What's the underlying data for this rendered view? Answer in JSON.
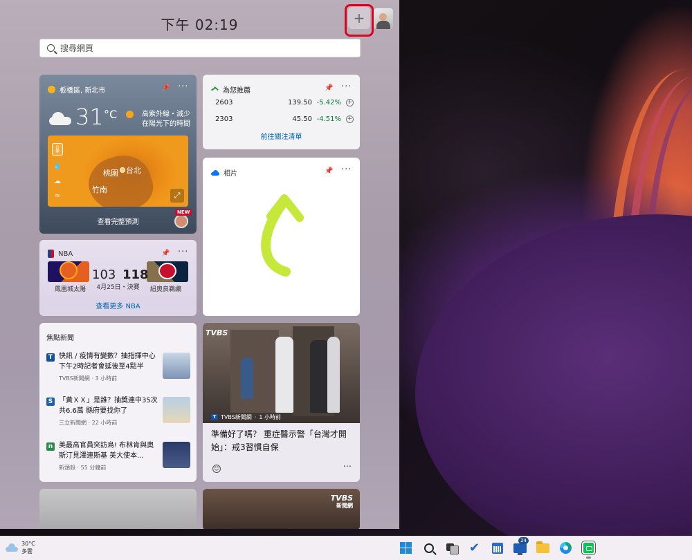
{
  "panel": {
    "time": "下午 02:19",
    "add_symbol": "+",
    "search_placeholder": "搜尋網頁"
  },
  "weather": {
    "location": "板橋區, 新北市",
    "temp": "31",
    "unit": "°C",
    "uv_text": "高紫外線・減少在陽光下的時間",
    "map_labels": [
      "桃園",
      "台北",
      "竹南"
    ],
    "link": "查看完整預測",
    "new_badge": "NEW"
  },
  "stocks": {
    "title": "為您推薦",
    "rows": [
      {
        "symbol": "2603",
        "price": "139.50",
        "change": "-5.42%"
      },
      {
        "symbol": "2303",
        "price": "45.50",
        "change": "-4.51%"
      }
    ],
    "link": "前往關注清單"
  },
  "photos": {
    "title": "相片"
  },
  "nba": {
    "title": "NBA",
    "home_score": "103",
    "away_score": "118",
    "date": "4月25日・決賽",
    "home_team": "鳳凰城太陽",
    "away_team": "紐奧良鵜鶘",
    "link": "查看更多 NBA"
  },
  "news": {
    "title": "焦點新聞",
    "items": [
      {
        "headline": "快訊 / 疫情有變數？抽指揮中心下午2時記者會延後至4點半",
        "source": "TVBS新聞網",
        "time": "3 小時前",
        "logo": "T",
        "logo_color": "#1450a0"
      },
      {
        "headline": "「黃ＸＸ」是誰？抽獎連中35次共6.6萬 縣府要找你了",
        "source": "三立新聞網",
        "time": "22 小時前",
        "logo": "S",
        "logo_color": "#1a5fb4"
      },
      {
        "headline": "美最高官員突訪烏! 布林肯與奧斯汀見澤連斯基 美大使本...",
        "source": "新頭殼",
        "time": "55 分鐘前",
        "logo": "n",
        "logo_color": "#2a8a4a"
      }
    ]
  },
  "bignews": {
    "watermark": "TVBS",
    "source": "TVBS新聞網",
    "time": "1 小時前",
    "headline": "準備好了嗎？ 重症醫示警「台灣才開始」：戒3習慣自保"
  },
  "bottom": {
    "watermark": "TVBS",
    "watermark_sub": "新聞網"
  },
  "taskbar": {
    "temp": "30°C",
    "condition": "多雲",
    "badge": "24"
  }
}
